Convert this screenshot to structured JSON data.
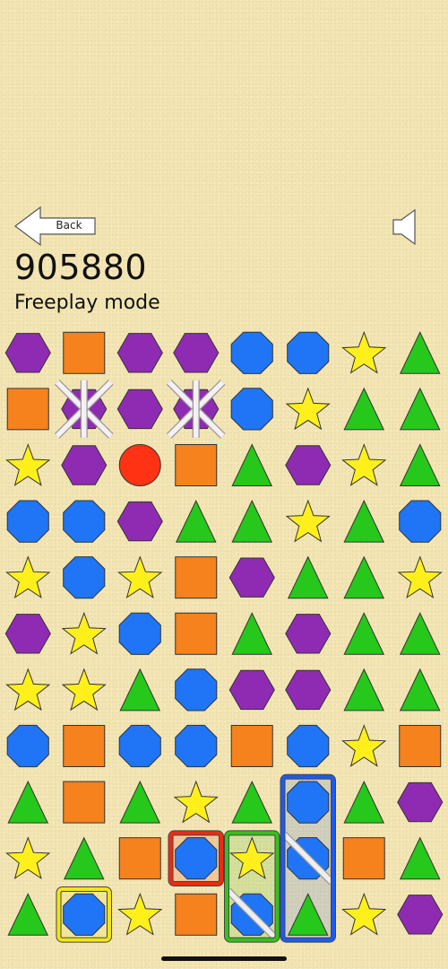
{
  "header": {
    "back_label": "Back",
    "sound_icon": "speaker-muted-icon",
    "score": "905880",
    "mode": "Freeplay mode"
  },
  "colors": {
    "hexagon": "#8f2bb3",
    "square": "#f6821e",
    "octagon": "#1f75f5",
    "star": "#fff01c",
    "triangle": "#26c81b",
    "circle": "#ff3214",
    "highlight_red": "#ee2a14",
    "highlight_green": "#36c11c",
    "highlight_blue": "#1c5bef",
    "highlight_yellow": "#f1e614"
  },
  "board": {
    "columns": 8,
    "rows": 11,
    "tiles": [
      [
        "hexagon",
        "square",
        "hexagon",
        "hexagon",
        "octagon",
        "octagon",
        "star",
        "triangle"
      ],
      [
        "square",
        "hexagon",
        "hexagon",
        "hexagon",
        "octagon",
        "star",
        "triangle",
        "triangle"
      ],
      [
        "star",
        "hexagon",
        "circle",
        "square",
        "triangle",
        "hexagon",
        "star",
        "triangle"
      ],
      [
        "octagon",
        "octagon",
        "hexagon",
        "triangle",
        "triangle",
        "star",
        "triangle",
        "octagon"
      ],
      [
        "star",
        "octagon",
        "star",
        "square",
        "hexagon",
        "triangle",
        "triangle",
        "star"
      ],
      [
        "hexagon",
        "star",
        "octagon",
        "square",
        "triangle",
        "hexagon",
        "triangle",
        "triangle"
      ],
      [
        "star",
        "star",
        "triangle",
        "octagon",
        "hexagon",
        "hexagon",
        "triangle",
        "triangle"
      ],
      [
        "octagon",
        "square",
        "octagon",
        "octagon",
        "square",
        "octagon",
        "star",
        "square"
      ],
      [
        "triangle",
        "square",
        "triangle",
        "star",
        "triangle",
        "octagon",
        "triangle",
        "hexagon"
      ],
      [
        "star",
        "triangle",
        "square",
        "octagon",
        "star",
        "octagon",
        "square",
        "triangle"
      ],
      [
        "triangle",
        "octagon",
        "star",
        "square",
        "octagon",
        "triangle",
        "star",
        "hexagon"
      ]
    ],
    "crossed_tiles": [
      [
        1,
        1
      ],
      [
        1,
        3
      ]
    ],
    "slashed_tiles": [
      [
        9,
        5
      ],
      [
        10,
        4
      ]
    ],
    "highlights": [
      {
        "name": "red-selection",
        "color": "highlight_red",
        "row": 9,
        "col": 3,
        "rows": 1,
        "cols": 1
      },
      {
        "name": "green-selection",
        "color": "highlight_green",
        "row": 9,
        "col": 4,
        "rows": 2,
        "cols": 1
      },
      {
        "name": "blue-selection",
        "color": "highlight_blue",
        "row": 8,
        "col": 5,
        "rows": 3,
        "cols": 1
      },
      {
        "name": "yellow-selection",
        "color": "highlight_yellow",
        "row": 10,
        "col": 1,
        "rows": 1,
        "cols": 1
      }
    ]
  }
}
